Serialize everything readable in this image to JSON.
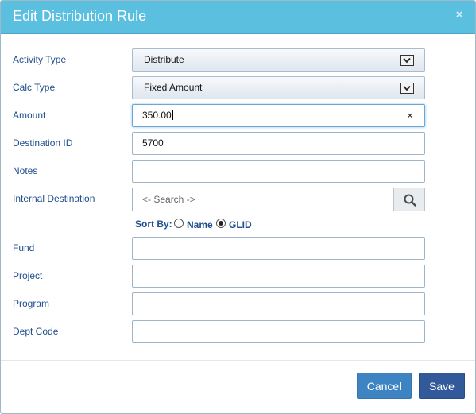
{
  "dialog": {
    "title": "Edit Distribution Rule",
    "close_glyph": "×"
  },
  "form": {
    "activity_type": {
      "label": "Activity Type",
      "value": "Distribute"
    },
    "calc_type": {
      "label": "Calc Type",
      "value": "Fixed Amount"
    },
    "amount": {
      "label": "Amount",
      "value": "350.00",
      "clear_glyph": "×"
    },
    "destination_id": {
      "label": "Destination ID",
      "value": "5700"
    },
    "notes": {
      "label": "Notes",
      "value": ""
    },
    "internal_destination": {
      "label": "Internal Destination",
      "placeholder": "<- Search ->"
    },
    "sort_by": {
      "label": "Sort By:",
      "options": [
        "Name",
        "GLID"
      ],
      "selected": "GLID"
    },
    "fund": {
      "label": "Fund",
      "value": ""
    },
    "project": {
      "label": "Project",
      "value": ""
    },
    "program": {
      "label": "Program",
      "value": ""
    },
    "dept_code": {
      "label": "Dept Code",
      "value": ""
    }
  },
  "footer": {
    "cancel_label": "Cancel",
    "save_label": "Save"
  },
  "icons": {
    "dropdown": "chevron-down-icon",
    "search": "search-icon",
    "close": "close-icon"
  },
  "colors": {
    "header_bg": "#5bbfe0",
    "label_text": "#1f4e8c",
    "cancel_bg": "#3f84c2",
    "save_bg": "#325a9a"
  }
}
